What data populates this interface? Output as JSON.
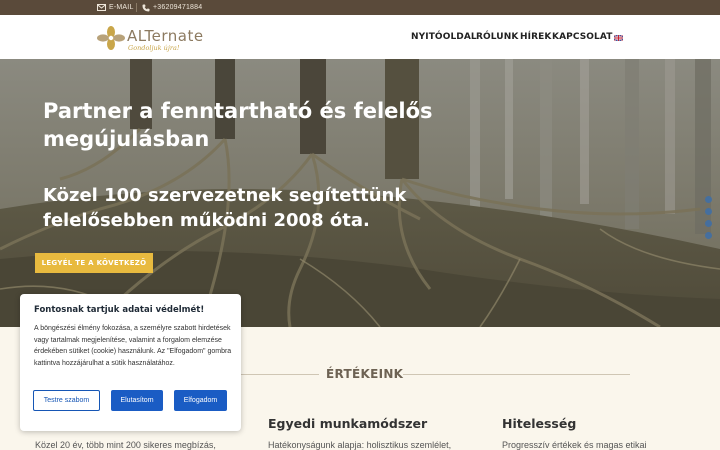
{
  "topbar": {
    "email_label": "E-MAIL",
    "phone_label": "+36209471884"
  },
  "logo": {
    "name": "ALTernate",
    "tagline": "Gondoljuk újra!"
  },
  "nav": {
    "items": [
      "NYITÓOLDAL",
      "RÓLUNK",
      "HÍREK",
      "KAPCSOLAT"
    ],
    "language_icon": "uk-flag-icon"
  },
  "hero": {
    "title": "Partner a fenntartható és felelős megújulásban",
    "subtitle": "Közel 100 szervezetnek segítettünk felelősebben működni 2008 óta.",
    "cta_label": "LEGYÉL TE A KÖVETKEZŐ"
  },
  "values": {
    "heading": "ÉRTÉKEINK",
    "columns": [
      {
        "title": "",
        "text": "Közel 20 év, több mint 200 sikeres megbízás,"
      },
      {
        "title": "Egyedi munkamódszer",
        "text": "Hatékonyságunk alapja: holisztikus szemlélet,"
      },
      {
        "title": "Hitelesség",
        "text": "Progresszív értékek és magas etikai"
      }
    ]
  },
  "cookie": {
    "title": "Fontosnak tartjuk adatai védelmét!",
    "text": "A böngészési élmény fokozása, a személyre szabott hirdetések vagy tartalmak megjelenítése, valamint a forgalom elemzése érdekében sütiket (cookie) használunk. Az \"Elfogadom\" gombra kattintva hozzájárulhat a sütik használatához.",
    "customize_label": "Testre szabom",
    "reject_label": "Elutasítom",
    "accept_label": "Elfogadom"
  },
  "colors": {
    "topbar": "#5a4a3a",
    "accent_gold": "#e8ba3f",
    "cookie_blue": "#1a5cc4",
    "section_bg": "#faf6ec"
  }
}
